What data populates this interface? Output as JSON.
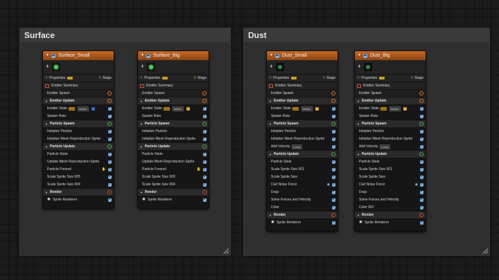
{
  "groups": [
    {
      "title": "Surface"
    },
    {
      "title": "Dust"
    }
  ],
  "properties_label": "Properties",
  "stage_label": "Stage",
  "emitter_summary_label": "Emitter Summary",
  "emitter_spawn_label": "Emitter Spawn",
  "emitter_update_label": "Emitter Update",
  "emitter_state_label": "Emitter State",
  "emitter_state_tag": "Self",
  "emitter_state_value": "Infinite",
  "spawn_rate_label": "Spawn Rate",
  "particle_spawn_label": "Particle Spawn",
  "initialize_particle_label": "Initialize Particle",
  "init_mesh_label": "Initialize Mesh Reproduction Sprite",
  "particle_update_label": "Particle Update",
  "particle_state_label": "Particle State",
  "render_label": "Render",
  "sprite_renderer_label": "Sprite Renderer",
  "nodes": {
    "surface_small": {
      "title": "Surface_Small",
      "update_items": [
        "Particle State",
        "Update Mesh Reproduction Sprite",
        "Particle Fresnel",
        "Scale Sprite Size 005",
        "Scale Sprite Size 004"
      ]
    },
    "surface_big": {
      "title": "Surface_Big",
      "update_items": [
        "Particle State",
        "Update Mesh Reproduction Sprite",
        "Particle Fresnel",
        "Scale Sprite Size 003",
        "Scale Sprite Size 004"
      ]
    },
    "dust_small": {
      "title": "Dust_Small",
      "add_velocity_label": "Add Velocity",
      "add_velocity_tag": "Linear",
      "update_items": [
        "Particle State",
        "Scale Sprite Size 001",
        "Scale Sprite Size",
        "Curl Noise Force",
        "Drag",
        "Solve Forces and Velocity",
        "Color"
      ]
    },
    "dust_big": {
      "title": "Dust_Big",
      "add_velocity_label": "Add Velocity",
      "add_velocity_tag": "Linear",
      "update_items": [
        "Particle State",
        "Scale Sprite Size 001",
        "Scale Sprite Size",
        "Curl Noise Force",
        "Drag",
        "Solve Forces and Velocity",
        "Color 001"
      ]
    }
  },
  "colors": {
    "header_orange": "#c56a26",
    "accent_blue": "#2f6fb8",
    "spawn_green": "#4fb84f",
    "render_red": "#d0453a"
  }
}
